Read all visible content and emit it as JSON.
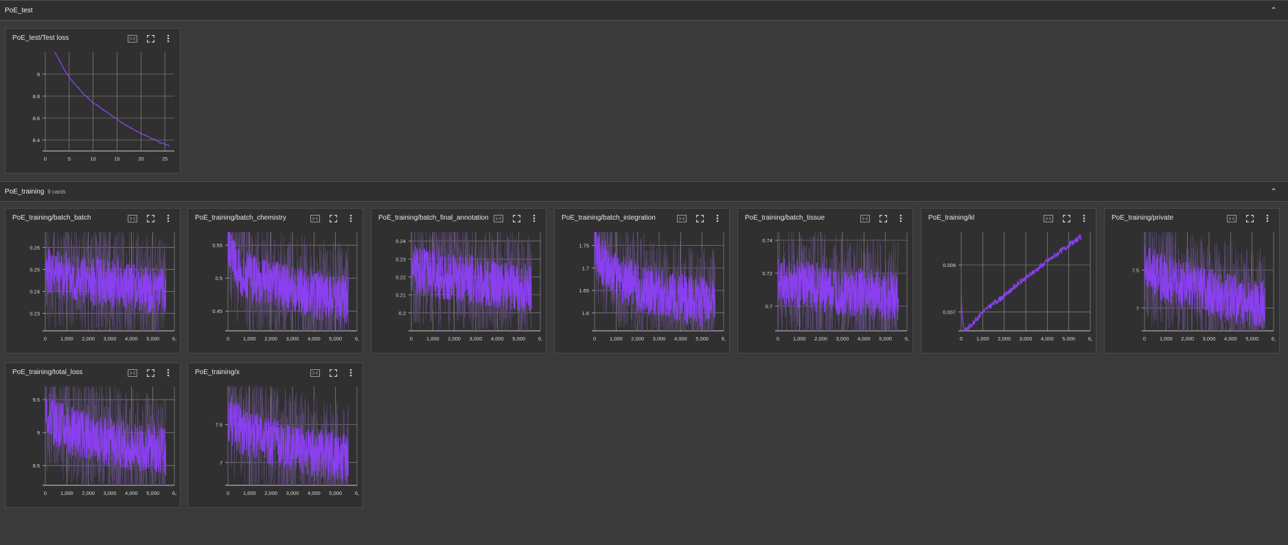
{
  "sections": [
    {
      "title": "PoE_test",
      "count": ""
    },
    {
      "title": "PoE_training",
      "count": "9 cards"
    }
  ],
  "colors": {
    "accent": "#8a3ff0",
    "background": "#3a3a3a",
    "card": "#303030",
    "grid": "#9a9a9a"
  },
  "icons": [
    "fit-domain-icon",
    "fullscreen-icon",
    "more-vert-icon",
    "collapse-icon"
  ],
  "chart_data": [
    {
      "title": "PoE_test/Test loss",
      "type": "line",
      "xlim": [
        0,
        27
      ],
      "ylim": [
        8.3,
        9.2
      ],
      "xticks": [
        0,
        5,
        10,
        15,
        20,
        25
      ],
      "xtick_labels": [
        "0",
        "5",
        "10",
        "15",
        "20",
        "25"
      ],
      "yticks": [
        8.4,
        8.6,
        8.8,
        9
      ],
      "ytick_labels": [
        "8.4",
        "8.6",
        "8.8",
        "9"
      ],
      "series": [
        {
          "x": [
            2,
            3,
            4,
            5,
            6,
            7,
            8,
            9,
            10,
            11,
            12,
            13,
            14,
            15,
            16,
            17,
            18,
            19,
            20,
            21,
            22,
            23,
            24,
            25,
            26
          ],
          "y": [
            9.2,
            9.12,
            9.04,
            8.97,
            8.92,
            8.87,
            8.82,
            8.78,
            8.74,
            8.71,
            8.68,
            8.65,
            8.62,
            8.59,
            8.56,
            8.53,
            8.51,
            8.48,
            8.46,
            8.44,
            8.42,
            8.4,
            8.38,
            8.36,
            8.35
          ]
        }
      ]
    },
    {
      "title": "PoE_training/batch_batch",
      "type": "line",
      "noise": true,
      "xlim": [
        0,
        6000
      ],
      "ylim": [
        0.222,
        0.267
      ],
      "xticks": [
        0,
        1000,
        2000,
        3000,
        4000,
        5000,
        6000
      ],
      "xtick_labels": [
        "0",
        "1,000",
        "2,000",
        "3,000",
        "4,000",
        "5,000",
        "6,"
      ],
      "yticks": [
        0.23,
        0.24,
        0.25,
        0.26
      ],
      "ytick_labels": [
        "0.23",
        "0.24",
        "0.25",
        "0.26"
      ],
      "series": [
        {
          "x": [
            0,
            1000,
            2000,
            3000,
            4000,
            5000,
            5600
          ],
          "y": [
            0.25,
            0.247,
            0.245,
            0.244,
            0.242,
            0.24,
            0.239
          ]
        }
      ]
    },
    {
      "title": "PoE_training/batch_chemistry",
      "type": "line",
      "noise": true,
      "xlim": [
        0,
        6000
      ],
      "ylim": [
        0.42,
        0.57
      ],
      "xticks": [
        0,
        1000,
        2000,
        3000,
        4000,
        5000,
        6000
      ],
      "xtick_labels": [
        "0",
        "1,000",
        "2,000",
        "3,000",
        "4,000",
        "5,000",
        "6,"
      ],
      "yticks": [
        0.45,
        0.5,
        0.55
      ],
      "ytick_labels": [
        "0.45",
        "0.5",
        "0.55"
      ],
      "series": [
        {
          "x": [
            0,
            200,
            600,
            1000,
            2000,
            3000,
            4000,
            5000,
            5600
          ],
          "y": [
            0.56,
            0.53,
            0.51,
            0.5,
            0.49,
            0.485,
            0.475,
            0.47,
            0.468
          ]
        }
      ]
    },
    {
      "title": "PoE_training/batch_final_annotation",
      "type": "line",
      "noise": true,
      "xlim": [
        0,
        6000
      ],
      "ylim": [
        0.19,
        0.245
      ],
      "xticks": [
        0,
        1000,
        2000,
        3000,
        4000,
        5000,
        6000
      ],
      "xtick_labels": [
        "0",
        "1,000",
        "2,000",
        "3,000",
        "4,000",
        "5,000",
        "6,"
      ],
      "yticks": [
        0.2,
        0.21,
        0.22,
        0.23,
        0.24
      ],
      "ytick_labels": [
        "0.2",
        "0.21",
        "0.22",
        "0.23",
        "0.24"
      ],
      "series": [
        {
          "x": [
            0,
            1000,
            2000,
            3000,
            4000,
            5000,
            5600
          ],
          "y": [
            0.225,
            0.222,
            0.22,
            0.218,
            0.216,
            0.214,
            0.213
          ]
        }
      ]
    },
    {
      "title": "PoE_training/batch_integration",
      "type": "line",
      "noise": true,
      "xlim": [
        0,
        6000
      ],
      "ylim": [
        1.56,
        1.78
      ],
      "xticks": [
        0,
        1000,
        2000,
        3000,
        4000,
        5000,
        6000
      ],
      "xtick_labels": [
        "0",
        "1,000",
        "2,000",
        "3,000",
        "4,000",
        "5,000",
        "6,"
      ],
      "yticks": [
        1.6,
        1.65,
        1.7,
        1.75
      ],
      "ytick_labels": [
        "1.6",
        "1.65",
        "1.7",
        "1.75"
      ],
      "series": [
        {
          "x": [
            0,
            300,
            800,
            1500,
            2500,
            3500,
            4500,
            5600
          ],
          "y": [
            1.76,
            1.72,
            1.69,
            1.67,
            1.65,
            1.64,
            1.63,
            1.62
          ]
        }
      ]
    },
    {
      "title": "PoE_training/batch_tissue",
      "type": "line",
      "noise": true,
      "xlim": [
        0,
        6000
      ],
      "ylim": [
        0.685,
        0.745
      ],
      "xticks": [
        0,
        1000,
        2000,
        3000,
        4000,
        5000,
        6000
      ],
      "xtick_labels": [
        "0",
        "1,000",
        "2,000",
        "3,000",
        "4,000",
        "5,000",
        "6,"
      ],
      "yticks": [
        0.7,
        0.72,
        0.74
      ],
      "ytick_labels": [
        "0.7",
        "0.72",
        "0.74"
      ],
      "series": [
        {
          "x": [
            0,
            1000,
            2000,
            3000,
            4000,
            5000,
            5600
          ],
          "y": [
            0.715,
            0.713,
            0.711,
            0.709,
            0.708,
            0.707,
            0.706
          ]
        }
      ]
    },
    {
      "title": "PoE_training/kl",
      "type": "line",
      "xlim": [
        0,
        6000
      ],
      "ylim": [
        0.0066,
        0.0087
      ],
      "xticks": [
        0,
        1000,
        2000,
        3000,
        4000,
        5000,
        6000
      ],
      "xtick_labels": [
        "0",
        "1,000",
        "2,000",
        "3,000",
        "4,000",
        "5,000",
        "6,"
      ],
      "yticks": [
        0.007,
        0.008
      ],
      "ytick_labels": [
        "0.007",
        "0.008"
      ],
      "series": [
        {
          "x": [
            0,
            50,
            150,
            300,
            600,
            1000,
            1500,
            2000,
            2500,
            3000,
            3500,
            4000,
            4500,
            5000,
            5600
          ],
          "y": [
            0.0074,
            0.0069,
            0.0066,
            0.00665,
            0.0068,
            0.007,
            0.00718,
            0.00735,
            0.00755,
            0.00772,
            0.0079,
            0.00808,
            0.00825,
            0.00842,
            0.0086
          ]
        }
      ]
    },
    {
      "title": "PoE_training/private",
      "type": "line",
      "noise": true,
      "xlim": [
        0,
        6000
      ],
      "ylim": [
        6.7,
        8.0
      ],
      "xticks": [
        0,
        1000,
        2000,
        3000,
        4000,
        5000,
        6000
      ],
      "xtick_labels": [
        "0",
        "1,000",
        "2,000",
        "3,000",
        "4,000",
        "5,000",
        "6,"
      ],
      "yticks": [
        7,
        7.5
      ],
      "ytick_labels": [
        "7",
        "7.5"
      ],
      "series": [
        {
          "x": [
            0,
            500,
            1000,
            2000,
            3000,
            4000,
            5000,
            5600
          ],
          "y": [
            7.6,
            7.45,
            7.38,
            7.28,
            7.2,
            7.13,
            7.08,
            7.05
          ]
        }
      ]
    },
    {
      "title": "PoE_training/total_loss",
      "type": "line",
      "noise": true,
      "xlim": [
        0,
        6000
      ],
      "ylim": [
        8.2,
        9.7
      ],
      "xticks": [
        0,
        1000,
        2000,
        3000,
        4000,
        5000,
        6000
      ],
      "xtick_labels": [
        "0",
        "1,000",
        "2,000",
        "3,000",
        "4,000",
        "5,000",
        "6,"
      ],
      "yticks": [
        8.5,
        9,
        9.5
      ],
      "ytick_labels": [
        "8.5",
        "9",
        "9.5"
      ],
      "series": [
        {
          "x": [
            0,
            500,
            1000,
            2000,
            3000,
            4000,
            5000,
            5600
          ],
          "y": [
            9.3,
            9.15,
            9.05,
            8.95,
            8.85,
            8.8,
            8.75,
            8.72
          ]
        }
      ]
    },
    {
      "title": "PoE_training/x",
      "type": "line",
      "noise": true,
      "xlim": [
        0,
        6000
      ],
      "ylim": [
        6.7,
        8.0
      ],
      "xticks": [
        0,
        1000,
        2000,
        3000,
        4000,
        5000,
        6000
      ],
      "xtick_labels": [
        "0",
        "1,000",
        "2,000",
        "3,000",
        "4,000",
        "5,000",
        "6,"
      ],
      "yticks": [
        7,
        7.5
      ],
      "ytick_labels": [
        "7",
        "7.5"
      ],
      "series": [
        {
          "x": [
            0,
            500,
            1000,
            2000,
            3000,
            4000,
            5000,
            5600
          ],
          "y": [
            7.6,
            7.45,
            7.38,
            7.28,
            7.2,
            7.13,
            7.08,
            7.05
          ]
        }
      ]
    }
  ]
}
